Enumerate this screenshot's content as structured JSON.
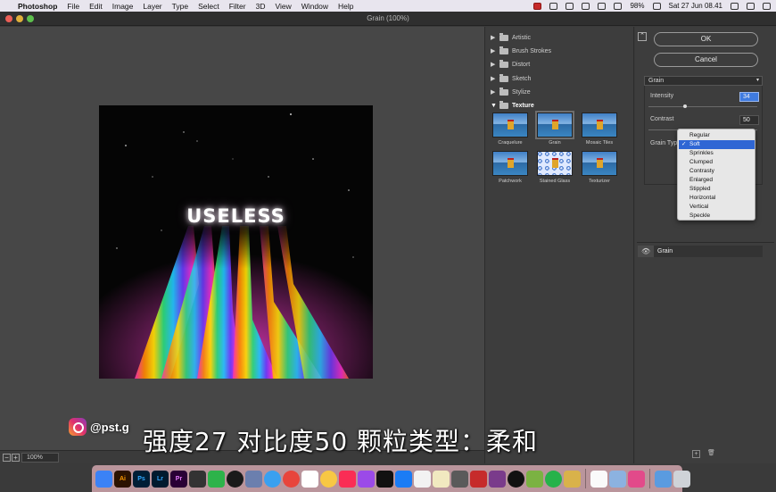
{
  "menubar": {
    "app": "Photoshop",
    "items": [
      "File",
      "Edit",
      "Image",
      "Layer",
      "Type",
      "Select",
      "Filter",
      "3D",
      "View",
      "Window",
      "Help"
    ],
    "battery": "98%",
    "datetime": "Sat 27 Jun  08.41"
  },
  "window": {
    "title": "Grain (100%)"
  },
  "canvas": {
    "text": "USELESS"
  },
  "bottom": {
    "zoom": "100%",
    "zoom_out": "−",
    "zoom_in": "+"
  },
  "gallery": {
    "categories": [
      {
        "label": "Artistic",
        "open": false
      },
      {
        "label": "Brush Strokes",
        "open": false
      },
      {
        "label": "Distort",
        "open": false
      },
      {
        "label": "Sketch",
        "open": false
      },
      {
        "label": "Stylize",
        "open": false
      },
      {
        "label": "Texture",
        "open": true
      }
    ],
    "thumbs": [
      "Craquelure",
      "Grain",
      "Mosaic Tiles",
      "Patchwork",
      "Stained Glass",
      "Texturizer"
    ],
    "selected": "Grain"
  },
  "panel": {
    "ok": "OK",
    "cancel": "Cancel",
    "filter": "Grain",
    "intensity_label": "Intensity",
    "intensity_value": "34",
    "contrast_label": "Contrast",
    "contrast_value": "50",
    "grain_type_label": "Grain Type",
    "grain_types": [
      "Regular",
      "Soft",
      "Sprinkles",
      "Clumped",
      "Contrasty",
      "Enlarged",
      "Stippled",
      "Horizontal",
      "Vertical",
      "Speckle"
    ],
    "selected_type": "Soft",
    "check": "✓",
    "layer_name": "Grain",
    "new_layer": "+",
    "delete_layer": "🗑"
  },
  "overlay": {
    "handle": "@pst.g",
    "subtitle": "强度27 对比度50 颗粒类型：柔和"
  },
  "colors": {
    "accent": "#2f66d4",
    "dialog_bg": "#3d3d3d"
  }
}
